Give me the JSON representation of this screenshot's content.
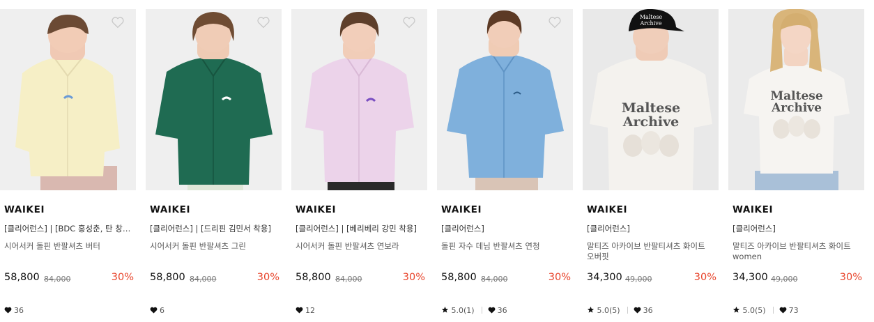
{
  "colors": {
    "accent_discount": "#e8452c",
    "heart_outline": "#c8c8c8"
  },
  "products": [
    {
      "brand": "WAIKEI",
      "tag": "[클리어런스] | [BDC 홍성춘, 탄 창…",
      "name": "시어서커 돌핀 반팔셔츠 버터",
      "price": "58,800",
      "original_price": "84,000",
      "discount": "30%",
      "rating": "",
      "likes": "36",
      "shirt_color": "#f6efc6",
      "bg_color": "#efefef"
    },
    {
      "brand": "WAIKEI",
      "tag": "[클리어런스] | [드리핀 김민서 착용]",
      "name": "시어서커 돌핀 반팔셔츠 그린",
      "price": "58,800",
      "original_price": "84,000",
      "discount": "30%",
      "rating": "",
      "likes": "6",
      "shirt_color": "#1f6b52",
      "bg_color": "#efefef"
    },
    {
      "brand": "WAIKEI",
      "tag": "[클리어런스] | [베리베리 강민 착용]",
      "name": "시어서커 돌핀 반팔셔츠 연보라",
      "price": "58,800",
      "original_price": "84,000",
      "discount": "30%",
      "rating": "",
      "likes": "12",
      "shirt_color": "#ecd3ea",
      "bg_color": "#efefef"
    },
    {
      "brand": "WAIKEI",
      "tag": "[클리어런스]",
      "name": "돌핀 자수 데님 반팔셔츠 연청",
      "price": "58,800",
      "original_price": "84,000",
      "discount": "30%",
      "rating": "5.0(1)",
      "likes": "36",
      "shirt_color": "#7fb0dc",
      "bg_color": "#efefef"
    },
    {
      "brand": "WAIKEI",
      "tag": "[클리어런스]",
      "name": "말티즈 아카이브 반팔티셔츠 화이트 오버핏",
      "price": "34,300",
      "original_price": "49,000",
      "discount": "30%",
      "rating": "5.0(5)",
      "likes": "36",
      "shirt_color": "#f4f2ee",
      "bg_color": "#e9e9e9",
      "print_text": [
        "Maltese",
        "Archive"
      ],
      "cap_text": [
        "Maltese",
        "Archive"
      ]
    },
    {
      "brand": "WAIKEI",
      "tag": "[클리어런스]",
      "name": "말티즈 아카이브 반팔티셔츠 화이트 women",
      "price": "34,300",
      "original_price": "49,000",
      "discount": "30%",
      "rating": "5.0(5)",
      "likes": "73",
      "shirt_color": "#f6f4f1",
      "bg_color": "#ebebeb",
      "print_text": [
        "Maltese",
        "Archive"
      ]
    }
  ]
}
